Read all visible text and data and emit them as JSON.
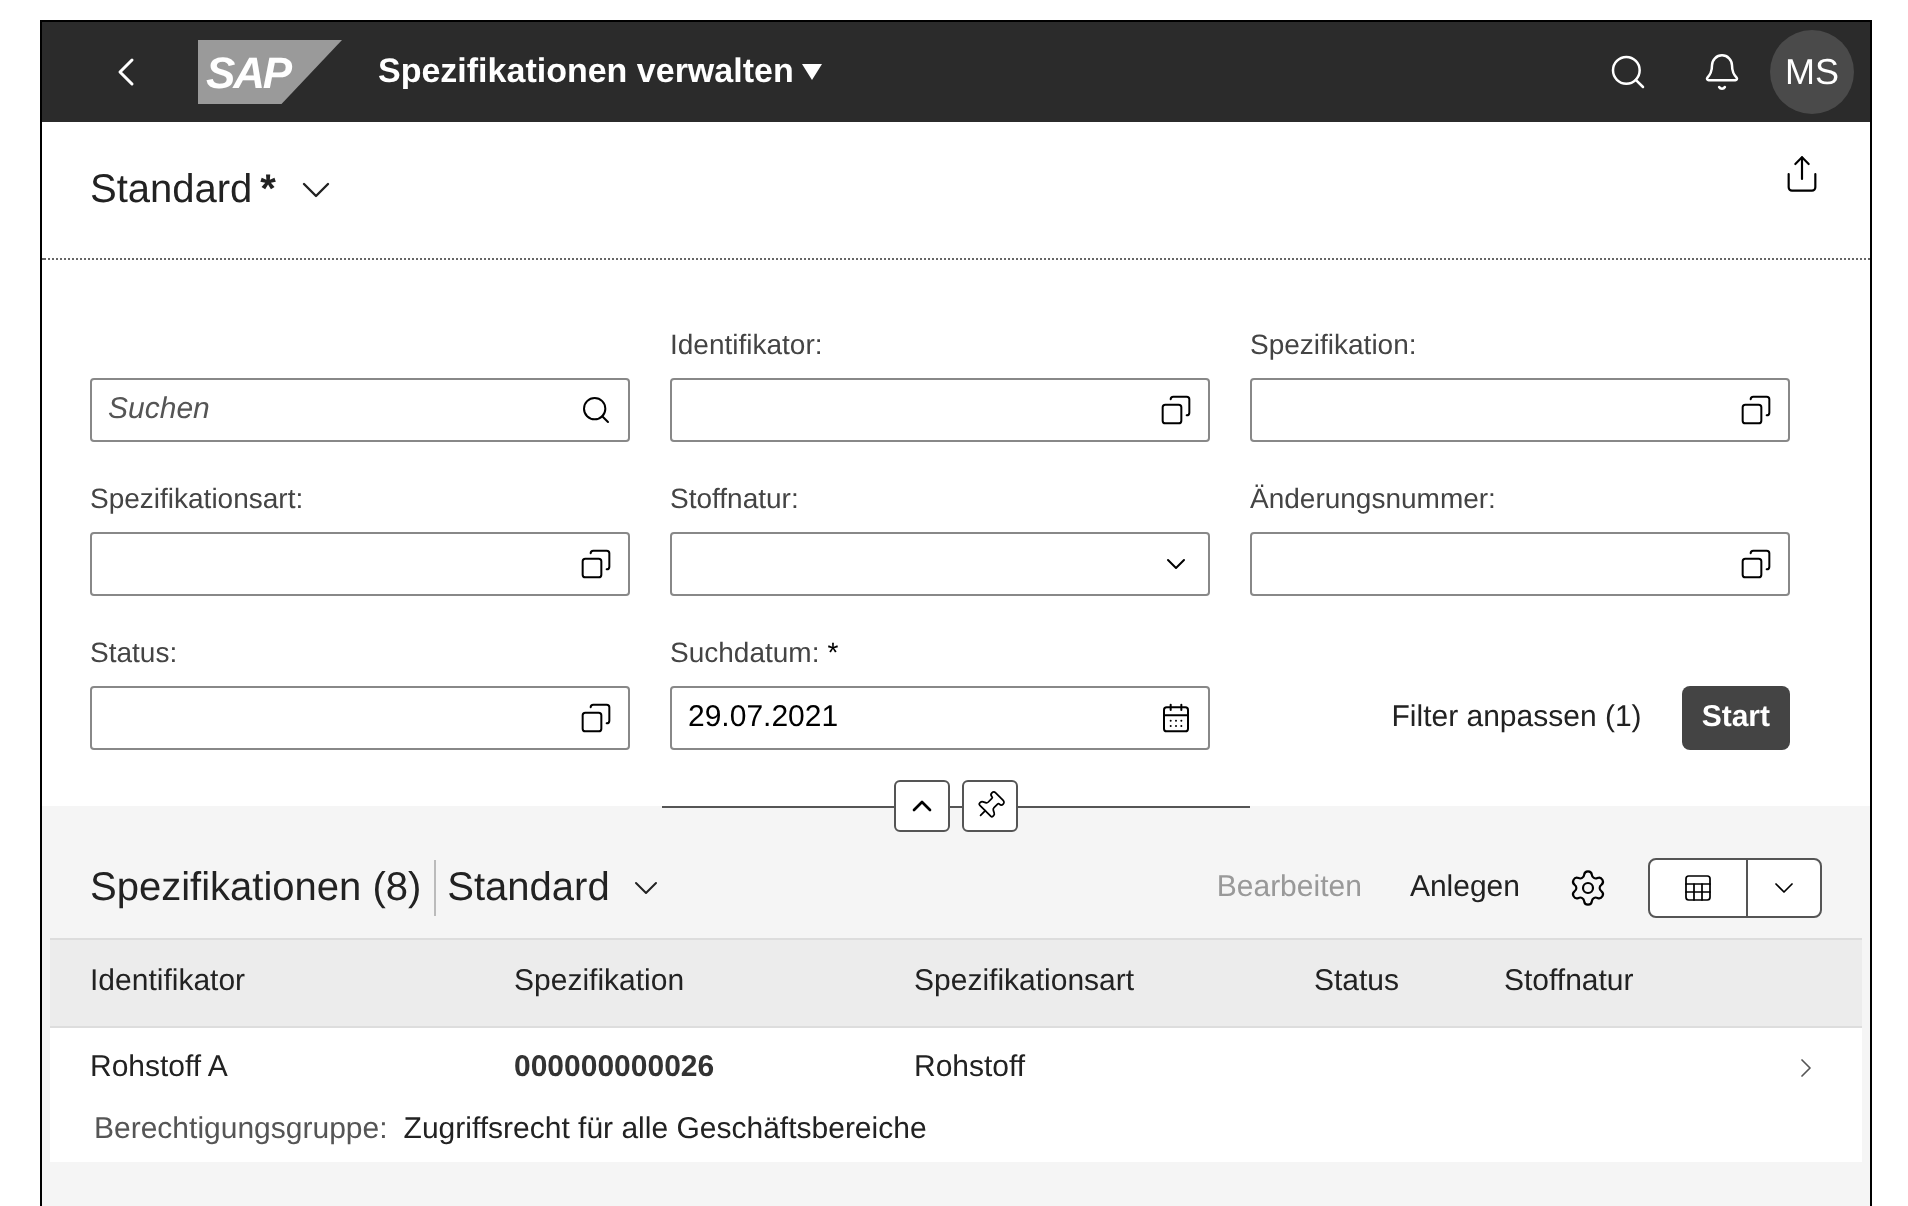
{
  "shell": {
    "logo": "SAP",
    "title": "Spezifikationen verwalten",
    "avatar": "MS"
  },
  "variant": {
    "name": "Standard",
    "modified_mark": "*"
  },
  "filters": [
    {
      "kind": "search",
      "placeholder": "Suchen"
    },
    {
      "kind": "valuehelp",
      "label": "Identifikator:"
    },
    {
      "kind": "valuehelp",
      "label": "Spezifikation:"
    },
    {
      "kind": "valuehelp",
      "label": "Spezifikationsart:"
    },
    {
      "kind": "dropdown",
      "label": "Stoffnatur:"
    },
    {
      "kind": "valuehelp",
      "label": "Änderungsnummer:"
    },
    {
      "kind": "valuehelp",
      "label": "Status:"
    },
    {
      "kind": "date",
      "label": "Suchdatum:",
      "required_mark": "*",
      "value": "29.07.2021"
    }
  ],
  "filter_actions": {
    "adapt": "Filter anpassen (1)",
    "go": "Start"
  },
  "table": {
    "title": "Spezifikationen (8)",
    "variant": "Standard",
    "actions": [
      {
        "label": "Bearbeiten",
        "disabled": true
      },
      {
        "label": "Anlegen",
        "disabled": false
      }
    ],
    "columns": [
      "Identifikator",
      "Spezifikation",
      "Spezifikationsart",
      "Status",
      "Stoffnatur"
    ],
    "rows": [
      {
        "cells": [
          "Rohstoff A",
          "000000000026",
          "Rohstoff",
          "",
          ""
        ],
        "detail_label": "Berechtigungsgruppe:",
        "detail_value": "Zugriffsrecht für alle Geschäftsbereiche"
      }
    ]
  }
}
